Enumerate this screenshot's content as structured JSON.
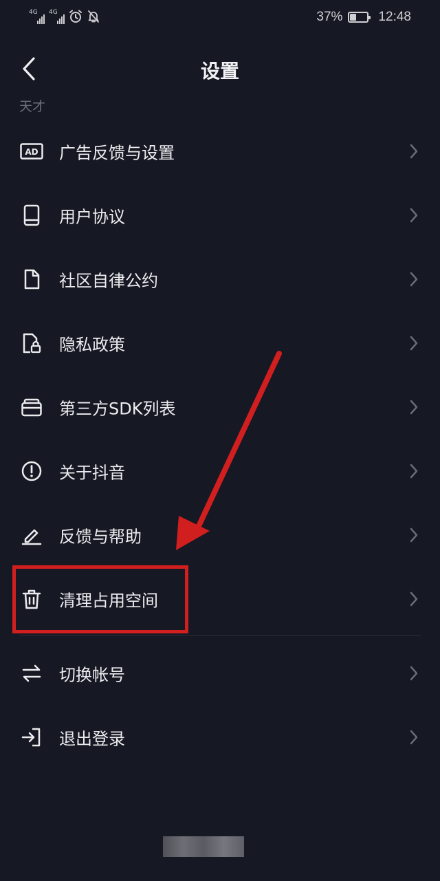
{
  "status_bar": {
    "network_1": "4G",
    "network_2": "4G",
    "battery_text": "37%",
    "battery_level": 0.37,
    "time": "12:48"
  },
  "header": {
    "title": "设置"
  },
  "section_label": "天才",
  "menu": [
    {
      "label": "广告反馈与设置",
      "icon": "ad-icon"
    },
    {
      "label": "用户协议",
      "icon": "book-icon"
    },
    {
      "label": "社区自律公约",
      "icon": "document-icon"
    },
    {
      "label": "隐私政策",
      "icon": "privacy-lock-icon"
    },
    {
      "label": "第三方SDK列表",
      "icon": "wallet-icon"
    },
    {
      "label": "关于抖音",
      "icon": "info-circle-icon"
    },
    {
      "label": "反馈与帮助",
      "icon": "pen-icon"
    },
    {
      "label": "清理占用空间",
      "icon": "trash-icon"
    }
  ],
  "account_menu": [
    {
      "label": "切换帐号",
      "icon": "switch-arrows-icon"
    },
    {
      "label": "退出登录",
      "icon": "logout-icon"
    }
  ],
  "annotation": {
    "color": "#d11f1f",
    "highlighted_item": "清理占用空间"
  },
  "colors": {
    "background": "#161823",
    "text": "#ececef",
    "muted": "#6d6f78"
  }
}
